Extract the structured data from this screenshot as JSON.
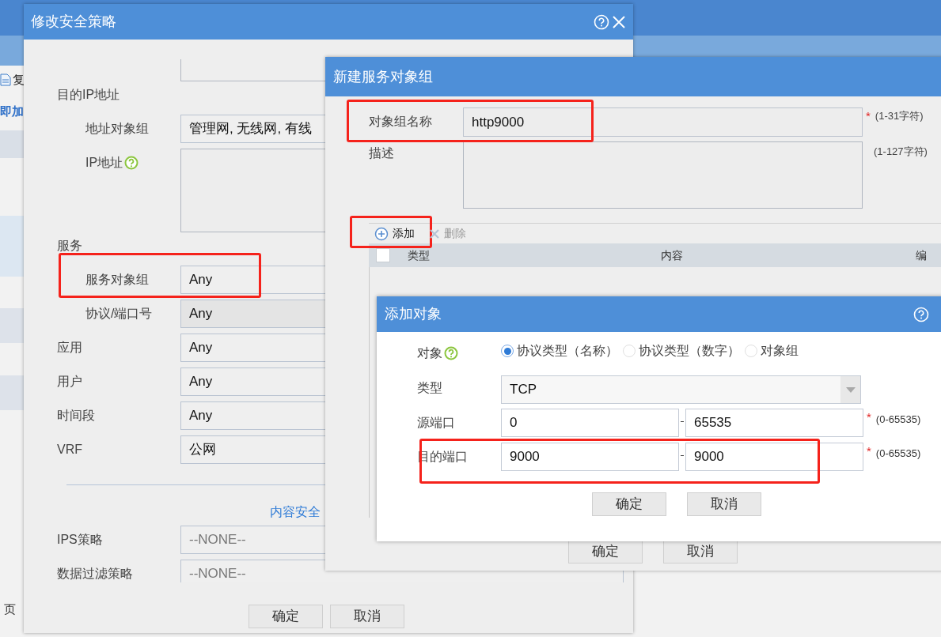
{
  "background": {
    "toolbar_button": "复",
    "link": "即加",
    "pager": "页"
  },
  "policy_dialog": {
    "title": "修改安全策略",
    "rows": [
      {
        "kind": "partial"
      },
      {
        "kind": "group",
        "label": "目的IP地址",
        "children": [
          {
            "kind": "field",
            "label": "地址对象组",
            "value": "管理网, 无线网, 有线",
            "disabled": false,
            "highlighted": false
          },
          {
            "kind": "textarea",
            "label": "IP地址",
            "help": true
          }
        ]
      },
      {
        "kind": "group",
        "label": "服务",
        "children": [
          {
            "kind": "field",
            "label": "服务对象组",
            "value": "Any",
            "disabled": false,
            "highlighted": true
          },
          {
            "kind": "field",
            "label": "协议/端口号",
            "value": "Any",
            "disabled": true,
            "highlighted": false
          }
        ]
      },
      {
        "kind": "field",
        "label": "应用",
        "value": "Any",
        "disabled": false,
        "highlighted": false
      },
      {
        "kind": "field",
        "label": "用户",
        "value": "Any",
        "disabled": false,
        "highlighted": false
      },
      {
        "kind": "field",
        "label": "时间段",
        "value": "Any",
        "disabled": false,
        "highlighted": false
      },
      {
        "kind": "field",
        "label": "VRF",
        "value": "公网",
        "disabled": false,
        "highlighted": false
      },
      {
        "kind": "section",
        "label": "内容安全"
      },
      {
        "kind": "select",
        "label": "IPS策略",
        "value": "--NONE--"
      },
      {
        "kind": "select",
        "label": "数据过滤策略",
        "value": "--NONE--"
      }
    ],
    "buttons": [
      "确定",
      "取消"
    ]
  },
  "group_dialog": {
    "title": "新建服务对象组",
    "name": {
      "label": "对象组名称",
      "value": "http9000",
      "required_mark": "*",
      "hint": "(1-31字符)",
      "highlighted": true
    },
    "description": {
      "label": "描述",
      "hint": "(1-127字符)"
    },
    "toolbar": [
      {
        "kind": "add",
        "label": "添加",
        "disabled": false,
        "highlighted": true
      },
      {
        "kind": "delete",
        "label": "删除",
        "disabled": true,
        "highlighted": false
      }
    ],
    "select_all_checked": false,
    "columns": [
      "类型",
      "内容",
      "编"
    ],
    "buttons": [
      "确定",
      "取消"
    ]
  },
  "add_dialog": {
    "title": "添加对象",
    "object": {
      "label": "对象",
      "options": [
        {
          "label": "协议类型（名称）",
          "selected": true
        },
        {
          "label": "协议类型（数字）",
          "selected": false
        },
        {
          "label": "对象组",
          "selected": false
        }
      ]
    },
    "type": {
      "label": "类型",
      "value": "TCP"
    },
    "ports": [
      {
        "label": "源端口",
        "from": "0",
        "to": "65535",
        "required_mark": "*",
        "hint": "(0-65535)",
        "highlighted": false
      },
      {
        "label": "目的端口",
        "from": "9000",
        "to": "9000",
        "required_mark": "*",
        "hint": "(0-65535)",
        "highlighted": true
      }
    ],
    "buttons": [
      "确定",
      "取消"
    ]
  }
}
